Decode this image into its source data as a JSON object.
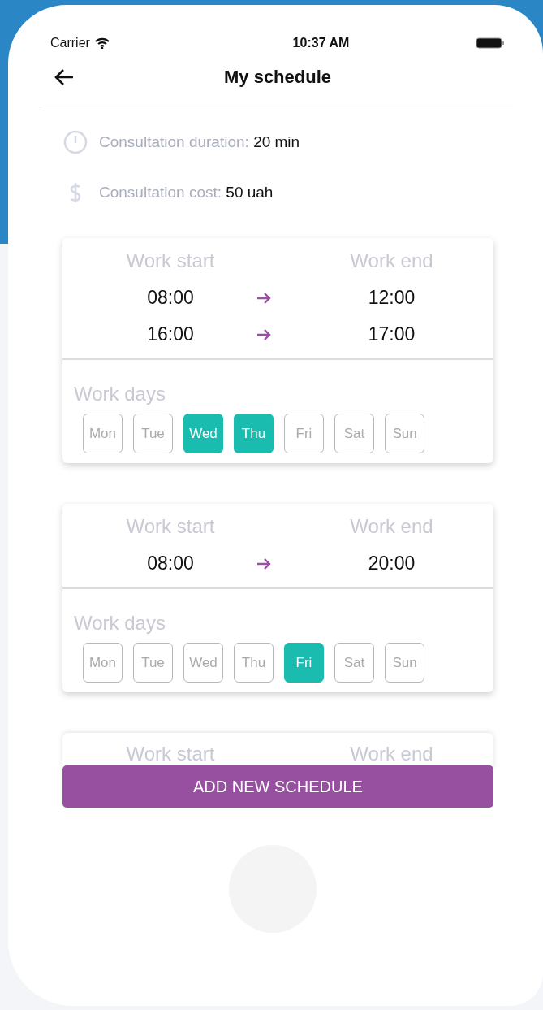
{
  "status_bar": {
    "carrier": "Carrier",
    "time": "10:37 AM"
  },
  "header": {
    "title": "My schedule"
  },
  "info": [
    {
      "kind": "clock",
      "label": "Consultation duration:",
      "value": "20 min"
    },
    {
      "kind": "dollar",
      "label": "Consultation cost:",
      "value": "50 uah"
    }
  ],
  "schedules": [
    {
      "start_label": "Work start",
      "end_label": "Work end",
      "ranges": [
        {
          "start": "08:00",
          "end": "12:00"
        },
        {
          "start": "16:00",
          "end": "17:00"
        }
      ],
      "days_label": "Work days",
      "days": [
        {
          "label": "Mon",
          "selected": false
        },
        {
          "label": "Tue",
          "selected": false
        },
        {
          "label": "Wed",
          "selected": true
        },
        {
          "label": "Thu",
          "selected": true
        },
        {
          "label": "Fri",
          "selected": false
        },
        {
          "label": "Sat",
          "selected": false
        },
        {
          "label": "Sun",
          "selected": false
        }
      ]
    },
    {
      "start_label": "Work start",
      "end_label": "Work end",
      "ranges": [
        {
          "start": "08:00",
          "end": "20:00"
        }
      ],
      "days_label": "Work days",
      "days": [
        {
          "label": "Mon",
          "selected": false
        },
        {
          "label": "Tue",
          "selected": false
        },
        {
          "label": "Wed",
          "selected": false
        },
        {
          "label": "Thu",
          "selected": false
        },
        {
          "label": "Fri",
          "selected": true
        },
        {
          "label": "Sat",
          "selected": false
        },
        {
          "label": "Sun",
          "selected": false
        }
      ]
    },
    {
      "start_label": "Work start",
      "end_label": "Work end"
    }
  ],
  "add_button": "ADD NEW SCHEDULE"
}
